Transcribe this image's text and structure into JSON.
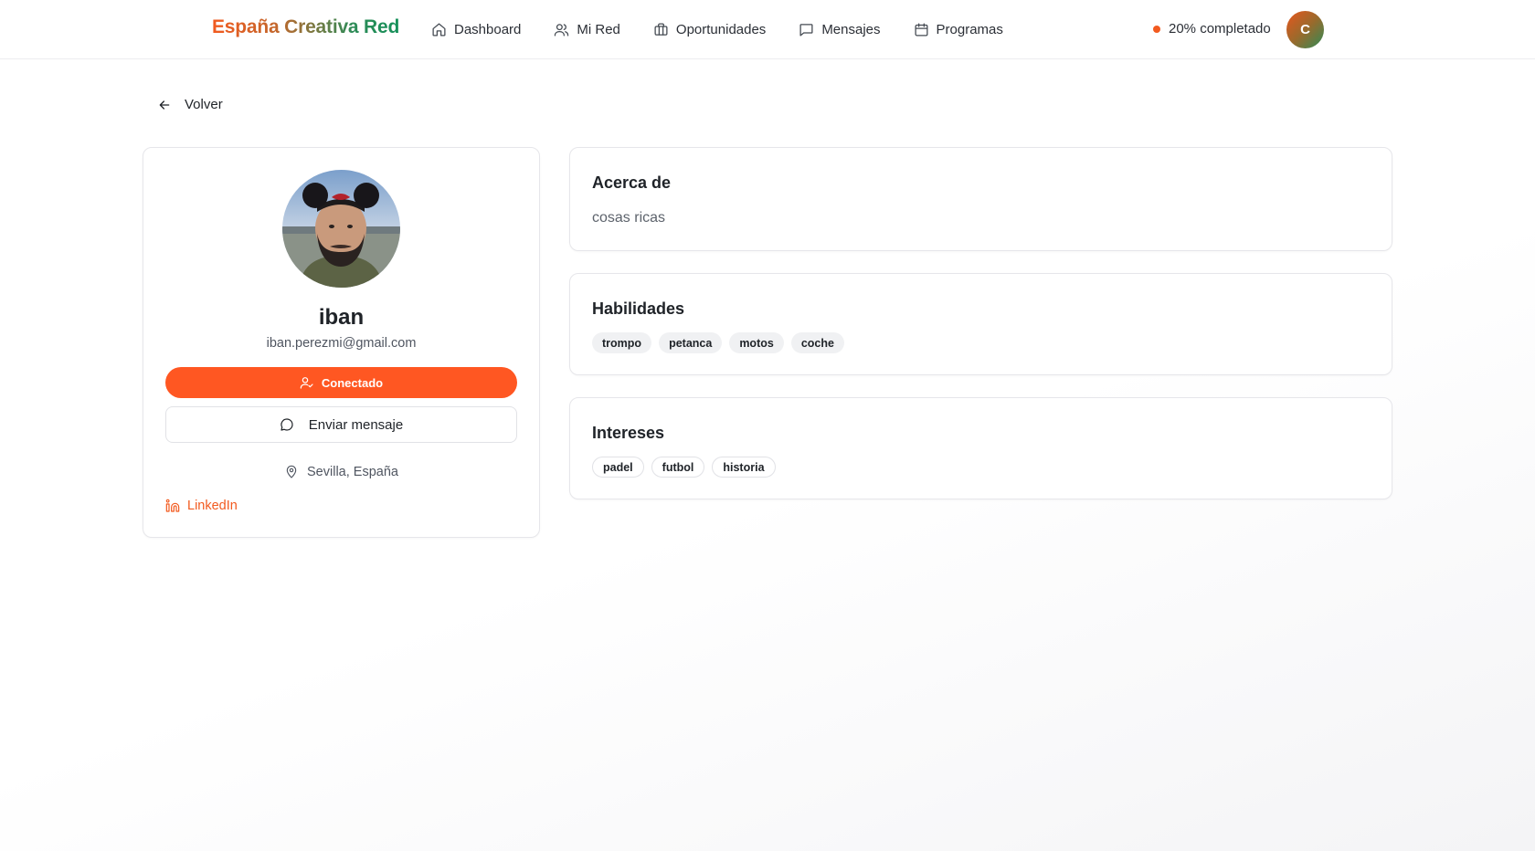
{
  "header": {
    "brand": "España Creativa Red",
    "nav": [
      {
        "label": "Dashboard",
        "icon": "home-icon"
      },
      {
        "label": "Mi Red",
        "icon": "users-icon"
      },
      {
        "label": "Oportunidades",
        "icon": "briefcase-icon"
      },
      {
        "label": "Mensajes",
        "icon": "message-icon"
      },
      {
        "label": "Programas",
        "icon": "calendar-icon"
      }
    ],
    "progress_text": "20% completado",
    "avatar_initial": "C"
  },
  "back_label": "Volver",
  "profile": {
    "name": "iban",
    "email": "iban.perezmi@gmail.com",
    "connected_label": "Conectado",
    "message_label": "Enviar mensaje",
    "location": "Sevilla, España",
    "linkedin_label": "LinkedIn"
  },
  "about": {
    "title": "Acerca de",
    "text": "cosas ricas"
  },
  "skills": {
    "title": "Habilidades",
    "items": [
      "trompo",
      "petanca",
      "motos",
      "coche"
    ]
  },
  "interests": {
    "title": "Intereses",
    "items": [
      "padel",
      "futbol",
      "historia"
    ]
  },
  "colors": {
    "accent": "#ff5722",
    "brand_start": "#f25a1f",
    "brand_end": "#15905a"
  }
}
